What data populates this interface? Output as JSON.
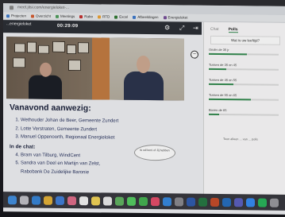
{
  "browser": {
    "url": "meet.jitsi.com/energieloket-..."
  },
  "bookmarks": [
    {
      "label": "Projecten",
      "color": "#3a7bd5"
    },
    {
      "label": "Overzicht",
      "color": "#e05a2a"
    },
    {
      "label": "Meetings",
      "color": "#4aa05a"
    },
    {
      "label": "Rabo",
      "color": "#d32f2f"
    },
    {
      "label": "RTD",
      "color": "#f4a32a"
    },
    {
      "label": "Excel",
      "color": "#2e7d32"
    },
    {
      "label": "Afbeeldingen",
      "color": "#3a7bd5"
    },
    {
      "label": "Energieloket",
      "color": "#7b4fa0"
    }
  ],
  "header": {
    "meeting_title": "...energieloket",
    "timer": "00:29:09",
    "settings_icon": "gear-icon",
    "fullscreen_icon": "expand-icon",
    "exit_icon": "exit-icon"
  },
  "video": {
    "minimize_icon": "minus-icon"
  },
  "main": {
    "heading": "Vanavond aanwezig:",
    "attendees": [
      "Wethouder Johan de Beer, Gemeente Zundert",
      "Lotte Verstraten, Gemeente Zundert",
      "Manuel Oppenoorth, Regionaal Energieloket"
    ],
    "chat_heading": "In de chat:",
    "chat_people": [
      "Bram van Tilburg, WindCent",
      "Sandra van Deel en Martijn van Zelst,",
      "Rabobank De Zuidelijke Baronie"
    ],
    "bubble_text": "Ik wil lerni of Jij hebben"
  },
  "poll": {
    "tabs": [
      "Chat",
      "Polls"
    ],
    "active_tab": "Polls",
    "question": "Wat is uw leeftijd?",
    "options": [
      {
        "label": "Onder de 35 jr",
        "percent": 55
      },
      {
        "label": "Tussen de 35 en 45",
        "percent": 25
      },
      {
        "label": "Tussen de 45 en 55",
        "percent": 35
      },
      {
        "label": "Tussen de 55 en 65",
        "percent": 60
      },
      {
        "label": "Boven de 65",
        "percent": 15
      }
    ],
    "footer": "Toon alleen ... van ... polls"
  },
  "dock": {
    "icons": [
      {
        "name": "finder-icon",
        "color": "#3a8fe8"
      },
      {
        "name": "launchpad-icon",
        "color": "#c0c0c8"
      },
      {
        "name": "safari-icon",
        "color": "#2f86e0"
      },
      {
        "name": "chrome-icon",
        "color": "#e8b02a"
      },
      {
        "name": "mail-icon",
        "color": "#3b7fe0"
      },
      {
        "name": "photos-icon",
        "color": "#e86a8a"
      },
      {
        "name": "calendar-icon",
        "color": "#f2f2f2"
      },
      {
        "name": "notes-icon",
        "color": "#f5d34a"
      },
      {
        "name": "reminders-icon",
        "color": "#eaeaea"
      },
      {
        "name": "maps-icon",
        "color": "#5ab45a"
      },
      {
        "name": "messages-icon",
        "color": "#4ccf5a"
      },
      {
        "name": "facetime-icon",
        "color": "#3cb54a"
      },
      {
        "name": "music-icon",
        "color": "#f14a6a"
      },
      {
        "name": "appstore-icon",
        "color": "#2f8ae8"
      },
      {
        "name": "settings-icon",
        "color": "#8a8a90"
      },
      {
        "name": "word-icon",
        "color": "#2b5cb8"
      },
      {
        "name": "excel-icon",
        "color": "#1f7a3f"
      },
      {
        "name": "powerpoint-icon",
        "color": "#d04a23"
      },
      {
        "name": "outlook-icon",
        "color": "#1f6fc8"
      },
      {
        "name": "teams-icon",
        "color": "#5a5fc8"
      },
      {
        "name": "zoom-icon",
        "color": "#2d8cff"
      },
      {
        "name": "spotify-icon",
        "color": "#1db954"
      },
      {
        "name": "trash-icon",
        "color": "#9a9aa0"
      }
    ]
  }
}
